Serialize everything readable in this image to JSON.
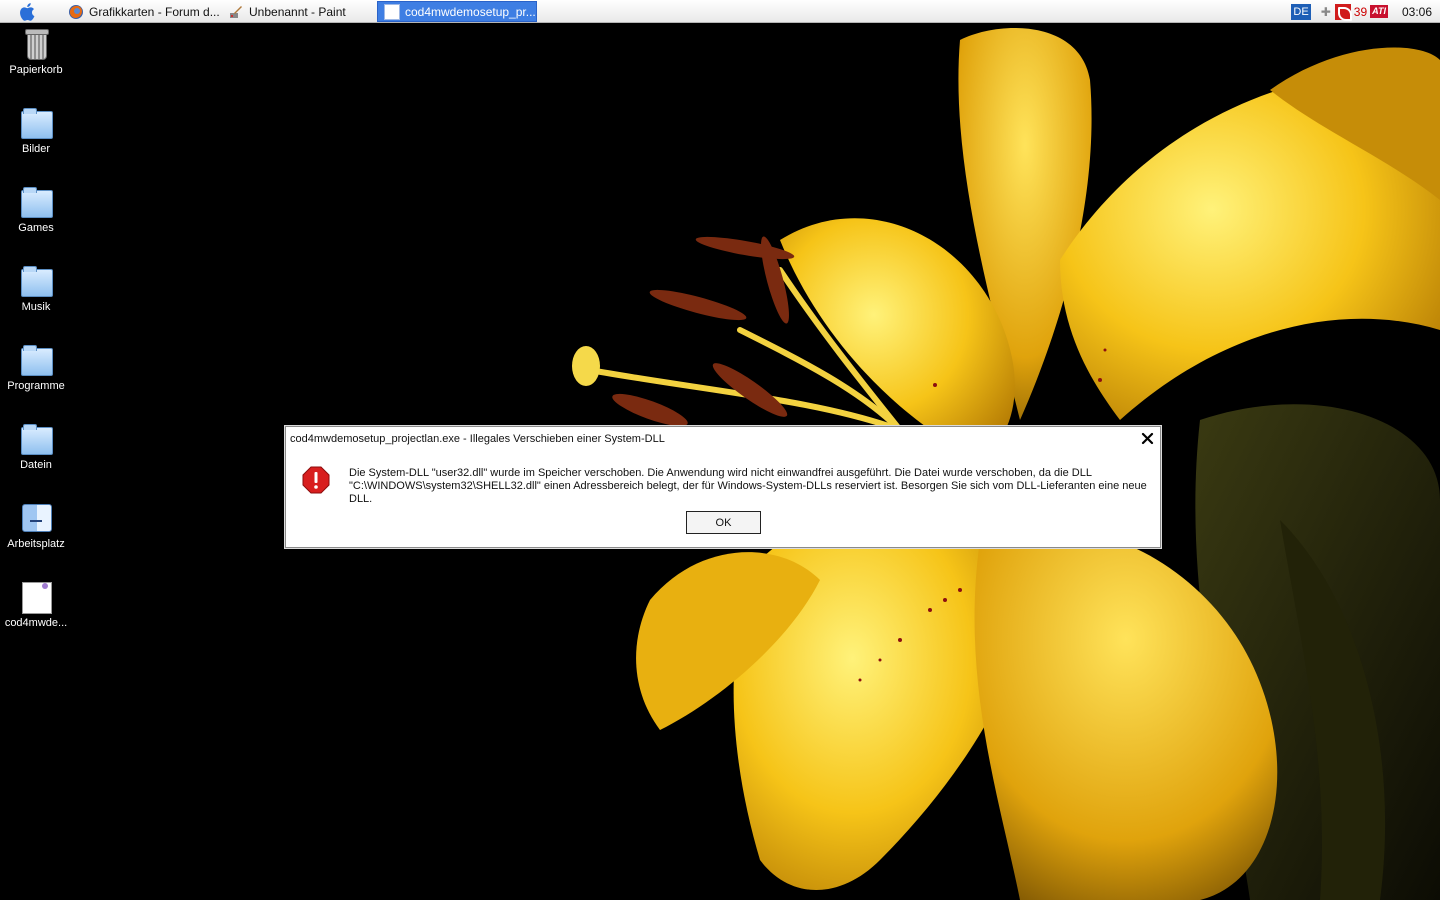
{
  "taskbar": {
    "tasks": [
      {
        "label": "Grafikkarten - Forum d...",
        "icon": "firefox-icon"
      },
      {
        "label": "Unbenannt - Paint",
        "icon": "paint-icon"
      },
      {
        "label": "cod4mwdemosetup_pr...",
        "icon": "window-icon",
        "active": true
      }
    ],
    "tray": {
      "language": "DE",
      "count": "39",
      "ati": "ATI",
      "clock": "03:06"
    }
  },
  "desktop": {
    "icons": [
      {
        "label": "Papierkorb",
        "icon": "trash-icon"
      },
      {
        "label": "Bilder",
        "icon": "folder-icon"
      },
      {
        "label": "Games",
        "icon": "folder-icon"
      },
      {
        "label": "Musik",
        "icon": "folder-icon"
      },
      {
        "label": "Programme",
        "icon": "folder-icon"
      },
      {
        "label": "Datein",
        "icon": "folder-icon"
      },
      {
        "label": "Arbeitsplatz",
        "icon": "computer-icon"
      },
      {
        "label": "cod4mwde...",
        "icon": "file-icon"
      }
    ]
  },
  "dialog": {
    "title": "cod4mwdemosetup_projectlan.exe - Illegales Verschieben einer System-DLL",
    "message_line1": "Die System-DLL \"user32.dll\" wurde im Speicher verschoben. Die Anwendung wird nicht einwandfrei ausgeführt. Die Datei wurde verschoben, da die DLL",
    "message_line2": "\"C:\\WINDOWS\\system32\\SHELL32.dll\" einen Adressbereich belegt, der für Windows-System-DLLs reserviert ist. Besorgen Sie sich vom DLL-Lieferanten eine neue DLL.",
    "ok_label": "OK"
  },
  "colors": {
    "accent": "#3e7ee3",
    "error_red": "#d81e1e",
    "petal_yellow": "#f5c21a"
  }
}
